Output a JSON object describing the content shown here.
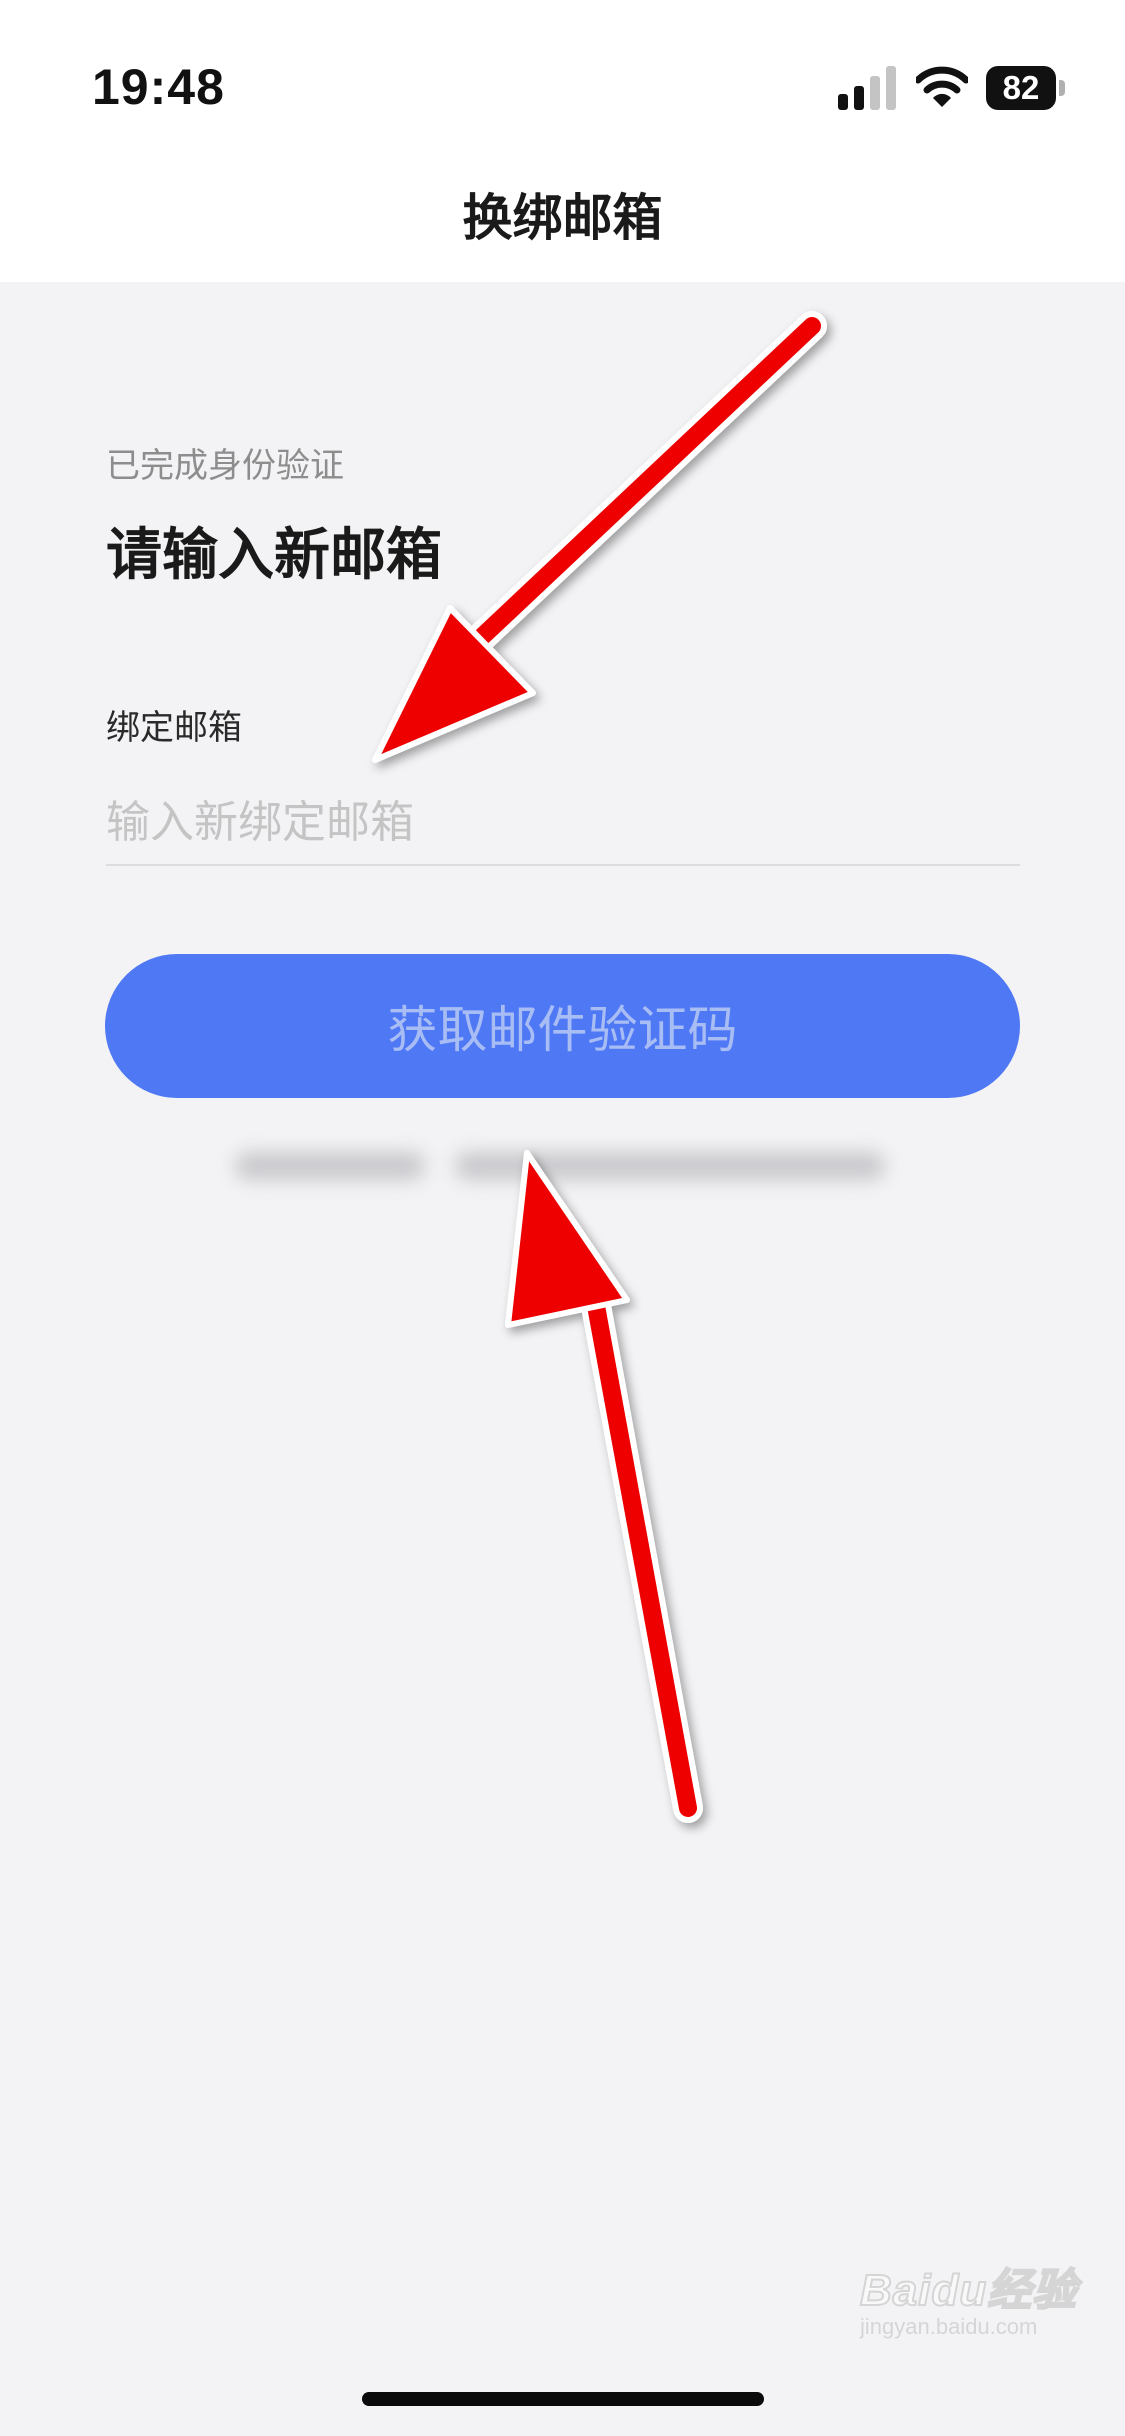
{
  "status_bar": {
    "time": "19:48",
    "battery_level": "82",
    "icons": [
      "signal-icon",
      "wifi-icon",
      "battery-icon"
    ]
  },
  "nav": {
    "title": "换绑邮箱"
  },
  "form": {
    "verified_text": "已完成身份验证",
    "heading": "请输入新邮箱",
    "field_label": "绑定邮箱",
    "input_value": "",
    "input_placeholder": "输入新绑定邮箱",
    "button_label": "获取邮件验证码"
  },
  "watermark": {
    "brand": "Baidu经验",
    "url": "jingyan.baidu.com"
  },
  "colors": {
    "background": "#f3f3f5",
    "button_bg": "#4f78f5",
    "button_text": "#a9bdf5",
    "annotation_arrow": "#ee0000"
  }
}
